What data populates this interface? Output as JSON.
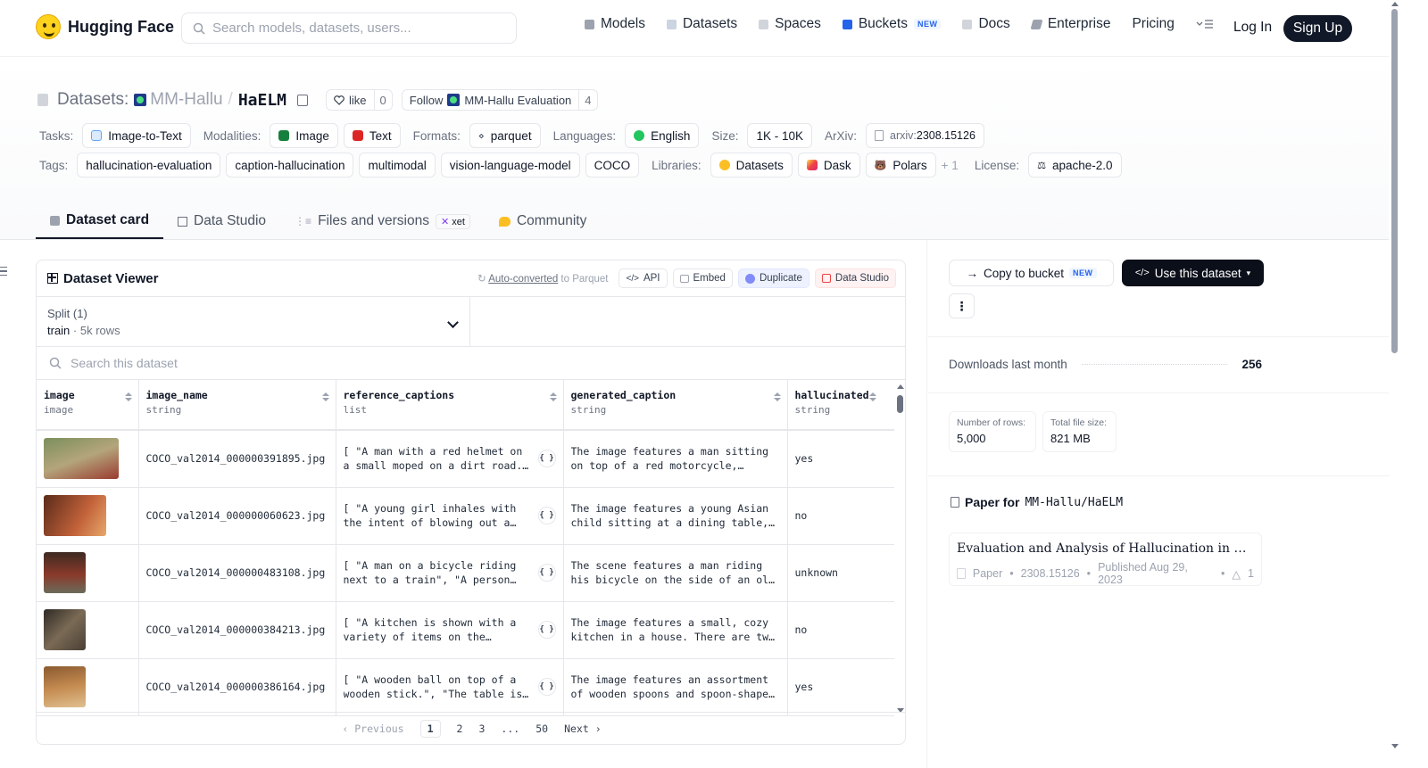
{
  "nav": {
    "brand": "Hugging Face",
    "search_placeholder": "Search models, datasets, users...",
    "links": [
      {
        "label": "Models",
        "icon": "cube-icon",
        "color": "#9ca3af"
      },
      {
        "label": "Datasets",
        "icon": "database-icon",
        "color": "#9ca3af"
      },
      {
        "label": "Spaces",
        "icon": "grid-icon",
        "color": "#9ca3af"
      },
      {
        "label": "Buckets",
        "icon": "bucket-icon",
        "color": "#2563eb",
        "badge": "NEW"
      },
      {
        "label": "Docs",
        "icon": "book-icon",
        "color": "#9ca3af"
      },
      {
        "label": "Enterprise",
        "icon": "enterprise-icon",
        "color": "#6b7280"
      },
      {
        "label": "Pricing"
      }
    ],
    "login": "Log In",
    "signup": "Sign Up"
  },
  "header": {
    "prefix": "Datasets:",
    "org": "MM-Hallu",
    "slash": "/",
    "name": "HaELM",
    "like_label": "like",
    "like_count": "0",
    "follow_label": "Follow",
    "follow_org": "MM-Hallu Evaluation",
    "follow_count": "4"
  },
  "meta_row1": {
    "tasks_label": "Tasks:",
    "task": "Image-to-Text",
    "modalities_label": "Modalities:",
    "modalities": [
      "Image",
      "Text"
    ],
    "formats_label": "Formats:",
    "format": "parquet",
    "languages_label": "Languages:",
    "language": "English",
    "size_label": "Size:",
    "size": "1K - 10K",
    "arxiv_label": "ArXiv:",
    "arxiv_prefix": "arxiv:",
    "arxiv_id": "2308.15126"
  },
  "meta_row2": {
    "tags_label": "Tags:",
    "tags": [
      "hallucination-evaluation",
      "caption-hallucination",
      "multimodal",
      "vision-language-model",
      "COCO"
    ],
    "libraries_label": "Libraries:",
    "libraries": [
      "Datasets",
      "Dask",
      "Polars"
    ],
    "more": "+ 1",
    "license_label": "License:",
    "license": "apache-2.0"
  },
  "tabs": [
    {
      "label": "Dataset card",
      "active": true
    },
    {
      "label": "Data Studio"
    },
    {
      "label": "Files and versions",
      "badge": "xet"
    },
    {
      "label": "Community"
    }
  ],
  "viewer": {
    "title": "Dataset Viewer",
    "auto_link": "Auto-converted",
    "auto_rest": " to Parquet",
    "actions": [
      "API",
      "Embed",
      "Duplicate",
      "Data Studio"
    ],
    "split_label": "Split (1)",
    "split_value": "train",
    "split_rows": "5k rows",
    "search_placeholder": "Search this dataset",
    "columns": [
      {
        "name": "image",
        "type": "image"
      },
      {
        "name": "image_name",
        "type": "string"
      },
      {
        "name": "reference_captions",
        "type": "list"
      },
      {
        "name": "generated_caption",
        "type": "string"
      },
      {
        "name": "hallucinated",
        "type": "string"
      }
    ],
    "rows": [
      {
        "image_name": "COCO_val2014_000000391895.jpg",
        "reference_captions": "[ \"A man with a red helmet on a small moped on a dirt road. \", \"Man riding a motor bike\" ]",
        "generated_caption": "The image features a man sitting on top of a red motorcycle, riding down a dirt road.",
        "hallucinated": "yes",
        "thumb_colors": [
          "#7b8f5c",
          "#b4a57b",
          "#9a3b2f"
        ]
      },
      {
        "image_name": "COCO_val2014_000000060623.jpg",
        "reference_captions": "[ \"A young girl inhales with the intent of blowing out a candle.\" ]",
        "generated_caption": "The image features a young Asian child sitting at a dining table, looking at a cake.",
        "hallucinated": "no",
        "thumb_colors": [
          "#5a2a1a",
          "#c2623a",
          "#e8a86a"
        ]
      },
      {
        "image_name": "COCO_val2014_000000483108.jpg",
        "reference_captions": "[ \"A man on a bicycle riding next to a train\", \"A person riding a bicycle\" ]",
        "generated_caption": "The scene features a man riding his bicycle on the side of an old train.",
        "hallucinated": "unknown",
        "thumb_colors": [
          "#3d2a22",
          "#8a3a2a",
          "#6b6b5a"
        ]
      },
      {
        "image_name": "COCO_val2014_000000384213.jpg",
        "reference_captions": "[ \"A kitchen is shown with a variety of items on the counters.\" ]",
        "generated_caption": "The image features a small, cozy kitchen in a house. There are two windows.",
        "hallucinated": "no",
        "thumb_colors": [
          "#2f2a24",
          "#7a6a55",
          "#4a3f35"
        ]
      },
      {
        "image_name": "COCO_val2014_000000386164.jpg",
        "reference_captions": "[ \"A wooden ball on top of a wooden stick.\", \"The table is full of spoons\" ]",
        "generated_caption": "The image features an assortment of wooden spoons and spoon-shaped utensils.",
        "hallucinated": "yes",
        "thumb_colors": [
          "#8a5a30",
          "#c48a50",
          "#e0c090"
        ]
      }
    ],
    "pager": {
      "prev": "Previous",
      "pages": [
        "1",
        "2",
        "3",
        "...",
        "50"
      ],
      "next": "Next"
    }
  },
  "sidebar": {
    "copy_btn": "Copy to bucket",
    "copy_badge": "NEW",
    "use_btn": "Use this dataset",
    "downloads_label": "Downloads last month",
    "downloads_value": "256",
    "rows_label": "Number of rows:",
    "rows_value": "5,000",
    "size_label": "Total file size:",
    "size_value": "821 MB",
    "paper_for": "Paper for",
    "paper_repo": "MM-Hallu/HaELM",
    "paper_title": "Evaluation and Analysis of Hallucination in Large Vision-Language Models",
    "paper_type": "Paper",
    "paper_id": "2308.15126",
    "paper_date": "Published Aug 29, 2023",
    "paper_upvotes": "1"
  }
}
